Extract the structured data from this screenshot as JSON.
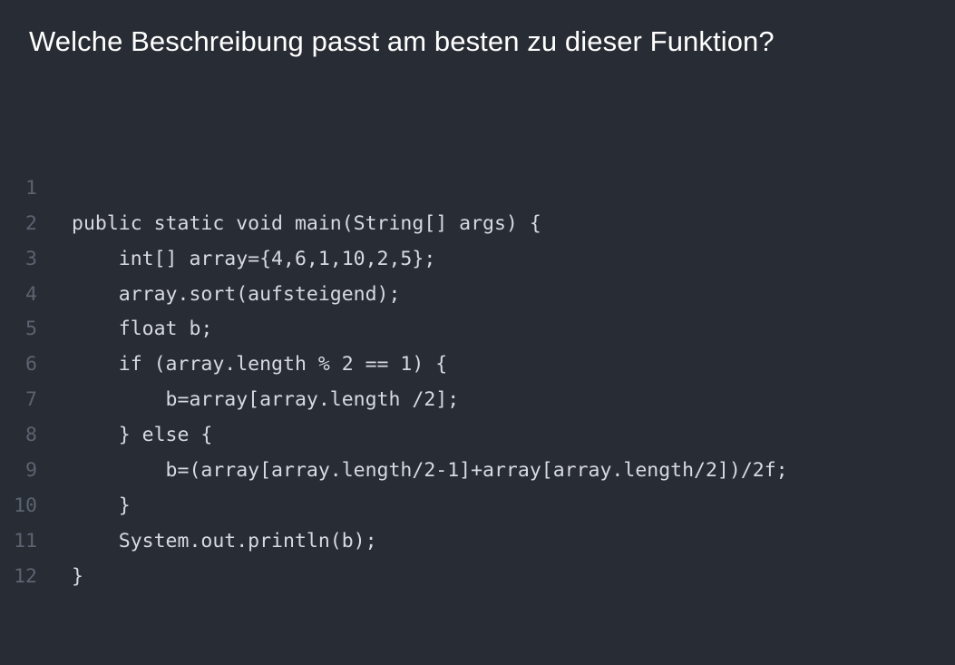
{
  "question": {
    "title": "Welche Beschreibung passt am besten zu dieser Funktion?"
  },
  "code": {
    "lines": [
      {
        "number": "1",
        "text": "public static void main(String[] args) {"
      },
      {
        "number": "2",
        "text": "    int[] array={4,6,1,10,2,5};"
      },
      {
        "number": "3",
        "text": "    array.sort(aufsteigend);"
      },
      {
        "number": "4",
        "text": "    float b;"
      },
      {
        "number": "5",
        "text": "    if (array.length % 2 == 1) {"
      },
      {
        "number": "6",
        "text": "        b=array[array.length /2];"
      },
      {
        "number": "7",
        "text": "    } else {"
      },
      {
        "number": "8",
        "text": "        b=(array[array.length/2-1]+array[array.length/2])/2f;"
      },
      {
        "number": "9",
        "text": "    }"
      },
      {
        "number": "10",
        "text": "    System.out.println(b);"
      },
      {
        "number": "11",
        "text": "}"
      },
      {
        "number": "12",
        "text": ""
      }
    ]
  },
  "colors": {
    "background": "#282c34",
    "title_text": "#ffffff",
    "code_text": "#d7dae0",
    "line_number": "#5c6370"
  }
}
